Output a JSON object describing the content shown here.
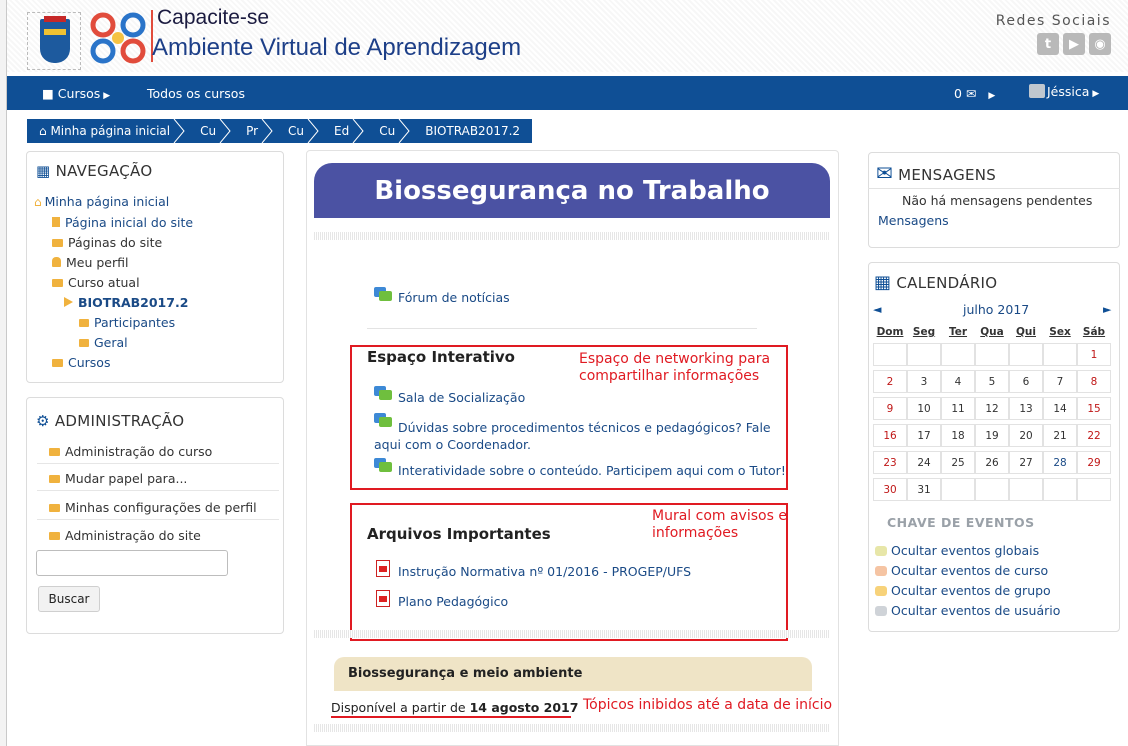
{
  "header": {
    "brand_title": "Capacite-se",
    "brand_subtitle": "Ambiente Virtual de Aprendizagem",
    "social_title": "Redes Sociais",
    "social_icons": [
      "twitter-icon",
      "youtube-icon",
      "globe-icon"
    ]
  },
  "navbar": {
    "courses_label": "Cursos",
    "all_courses_label": "Todos os cursos",
    "messages_count": "0",
    "user_name": "Jéssica"
  },
  "breadcrumb": [
    "Minha página inicial",
    "Cu",
    "Pr",
    "Cu",
    "Ed",
    "Cu",
    "BIOTRAB2017.2"
  ],
  "navigation": {
    "title": "NAVEGAÇÃO",
    "items": [
      {
        "label": "Minha página inicial"
      },
      {
        "label": "Página inicial do site"
      },
      {
        "label": "Páginas do site"
      },
      {
        "label": "Meu perfil"
      },
      {
        "label": "Curso atual"
      },
      {
        "label": "BIOTRAB2017.2"
      },
      {
        "label": "Participantes"
      },
      {
        "label": "Geral"
      },
      {
        "label": "Cursos"
      }
    ]
  },
  "administration": {
    "title": "ADMINISTRAÇÃO",
    "items": [
      "Administração do curso",
      "Mudar papel para...",
      "Minhas configurações de perfil",
      "Administração do site"
    ],
    "search_value": "",
    "search_button": "Buscar"
  },
  "main": {
    "course_title": "Biossegurança no Trabalho",
    "news_forum": "Fórum de notícias",
    "interactive": {
      "heading": "Espaço Interativo",
      "note": "Espaço de networking para compartilhar informações",
      "links": [
        "Sala de Socialização",
        "Dúvidas sobre procedimentos técnicos e pedagógicos? Fale aqui com o Coordenador.",
        "Interatividade sobre o conteúdo. Participem aqui com o Tutor!"
      ]
    },
    "files": {
      "heading": "Arquivos Importantes",
      "note": "Mural com avisos e informações",
      "links": [
        "Instrução Normativa nº 01/2016 - PROGEP/UFS",
        "Plano Pedagógico"
      ]
    },
    "topic": {
      "title": "Biossegurança e meio ambiente",
      "available_prefix": "Disponível a partir de",
      "available_date": "14 agosto 2017",
      "note": "Tópicos inibidos até a data de início"
    }
  },
  "messages": {
    "title": "MENSAGENS",
    "empty_text": "Não há mensagens pendentes",
    "link": "Mensagens"
  },
  "calendar": {
    "title": "CALENDÁRIO",
    "month": "julho 2017",
    "prev": "◄",
    "next": "►",
    "weekdays": [
      "Dom",
      "Seg",
      "Ter",
      "Qua",
      "Qui",
      "Sex",
      "Sáb"
    ],
    "weeks": [
      [
        "",
        "",
        "",
        "",
        "",
        "",
        "1"
      ],
      [
        "2",
        "3",
        "4",
        "5",
        "6",
        "7",
        "8"
      ],
      [
        "9",
        "10",
        "11",
        "12",
        "13",
        "14",
        "15"
      ],
      [
        "16",
        "17",
        "18",
        "19",
        "20",
        "21",
        "22"
      ],
      [
        "23",
        "24",
        "25",
        "26",
        "27",
        "28",
        "29"
      ],
      [
        "30",
        "31",
        "",
        "",
        "",
        "",
        ""
      ]
    ],
    "events_key_title": "CHAVE DE EVENTOS",
    "events_key": [
      {
        "label": "Ocultar eventos globais",
        "color": "#e7e6a8"
      },
      {
        "label": "Ocultar eventos de curso",
        "color": "#f5c4a3"
      },
      {
        "label": "Ocultar eventos de grupo",
        "color": "#f7d27a"
      },
      {
        "label": "Ocultar eventos de usuário",
        "color": "#cfd3d8"
      }
    ]
  },
  "colors": {
    "navbar": "#0f4f95",
    "title_banner": "#4b52a3",
    "annotation_red": "#e01a22",
    "link_blue": "#1a4a86",
    "folder_gold": "#f0b23e"
  }
}
